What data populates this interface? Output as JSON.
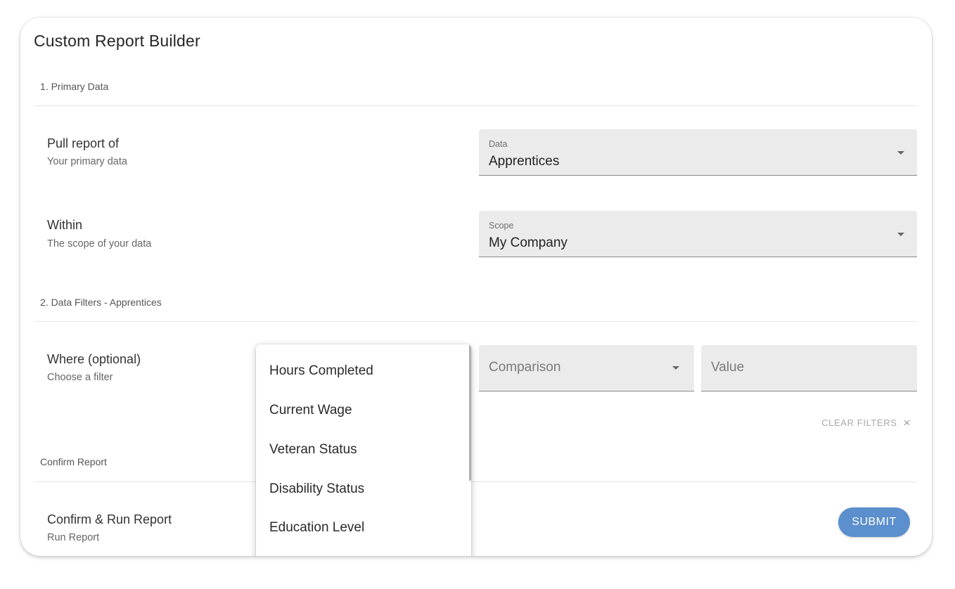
{
  "card": {
    "title": "Custom Report Builder"
  },
  "sections": {
    "primary": "1. Primary Data",
    "filters": "2. Data Filters - Apprentices",
    "confirm": "Confirm Report"
  },
  "rows": {
    "pull": {
      "title": "Pull report of",
      "subtitle": "Your primary data"
    },
    "within": {
      "title": "Within",
      "subtitle": "The scope of your data"
    },
    "where": {
      "title": "Where (optional)",
      "subtitle": "Choose a filter"
    },
    "confirm": {
      "title": "Confirm & Run Report",
      "subtitle": "Run Report"
    }
  },
  "fields": {
    "data": {
      "label": "Data",
      "value": "Apprentices"
    },
    "scope": {
      "label": "Scope",
      "value": "My Company"
    },
    "comparison": {
      "placeholder": "Comparison"
    },
    "value": {
      "placeholder": "Value"
    }
  },
  "filter_options": [
    "Hours Completed",
    "Current Wage",
    "Veteran Status",
    "Disability Status",
    "Education Level"
  ],
  "actions": {
    "clear_filters": "CLEAR FILTERS",
    "clear_icon": "×",
    "submit": "SUBMIT"
  },
  "colors": {
    "accent": "#5b8fcd",
    "field_bg": "#ebebeb"
  }
}
